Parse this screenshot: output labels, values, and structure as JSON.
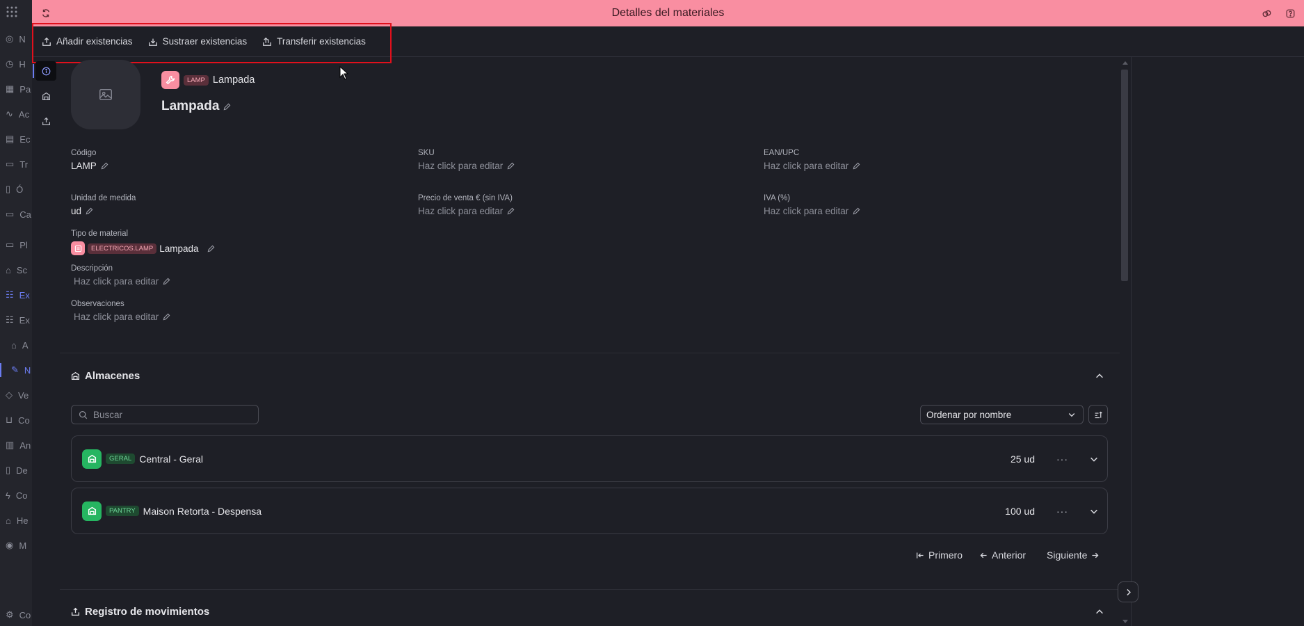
{
  "header": {
    "title": "Detalles del materiales"
  },
  "toolbar": {
    "add_stock": "Añadir existencias",
    "subtract_stock": "Sustraer existencias",
    "transfer_stock": "Transferir existencias"
  },
  "app_rail": {
    "items": [
      {
        "icon": "globe-icon",
        "label": "N"
      },
      {
        "icon": "clock-icon",
        "label": "H"
      },
      {
        "icon": "dashboard-icon",
        "label": "Pa"
      },
      {
        "icon": "activity-icon",
        "label": "Ac"
      },
      {
        "icon": "building-icon",
        "label": "Ec"
      },
      {
        "icon": "calendar-icon",
        "label": "Tr"
      },
      {
        "icon": "clipboard-icon",
        "label": "Ó"
      },
      {
        "icon": "calendar-icon",
        "label": "Ca"
      },
      {
        "icon": "calendar-icon",
        "label": "Pl"
      },
      {
        "icon": "tray-icon",
        "label": "Sc"
      },
      {
        "icon": "users-icon",
        "label": "Ex"
      },
      {
        "icon": "users-icon",
        "label": "Ex"
      },
      {
        "icon": "warehouse-icon",
        "label": "A"
      },
      {
        "icon": "wrench-icon",
        "label": "N"
      },
      {
        "icon": "tag-icon",
        "label": "Ve"
      },
      {
        "icon": "cart-icon",
        "label": "Co"
      },
      {
        "icon": "chart-icon",
        "label": "An"
      },
      {
        "icon": "document-icon",
        "label": "De"
      },
      {
        "icon": "plug-icon",
        "label": "Co"
      },
      {
        "icon": "home-icon",
        "label": "He"
      },
      {
        "icon": "pin-icon",
        "label": "M"
      },
      {
        "icon": "gear-icon",
        "label": "Co"
      }
    ]
  },
  "material": {
    "code_badge": "LAMP",
    "code_name": "Lampada",
    "name": "Lampada",
    "fields": {
      "codigo": {
        "label": "Código",
        "value": "LAMP"
      },
      "sku": {
        "label": "SKU",
        "value": "Haz click para editar"
      },
      "ean": {
        "label": "EAN/UPC",
        "value": "Haz click para editar"
      },
      "unidad": {
        "label": "Unidad de medida",
        "value": "ud"
      },
      "precio": {
        "label": "Precio de venta € (sin IVA)",
        "value": "Haz click para editar"
      },
      "iva": {
        "label": "IVA (%)",
        "value": "Haz click para editar"
      },
      "tipo": {
        "label": "Tipo de material",
        "badge": "ELECTRICOS.LAMP",
        "value": "Lampada"
      },
      "descripcion": {
        "label": "Descripción",
        "value": "Haz click para editar"
      },
      "observaciones": {
        "label": "Observaciones",
        "value": "Haz click para editar"
      }
    }
  },
  "almacenes": {
    "title": "Almacenes",
    "search_placeholder": "Buscar",
    "sort_selected": "Ordenar por nombre",
    "items": [
      {
        "badge": "GERAL",
        "name": "Central - Geral",
        "qty": "25 ud"
      },
      {
        "badge": "PANTRY",
        "name": "Maison Retorta - Despensa",
        "qty": "100 ud"
      }
    ],
    "pager": {
      "first": "Primero",
      "prev": "Anterior",
      "next": "Siguiente"
    }
  },
  "movimientos": {
    "title": "Registro de movimientos"
  },
  "colors": {
    "header_bg": "#f98ea1",
    "accent": "#6b7cf0",
    "warehouse_green": "#26b561",
    "highlight_red": "#e1101c"
  }
}
